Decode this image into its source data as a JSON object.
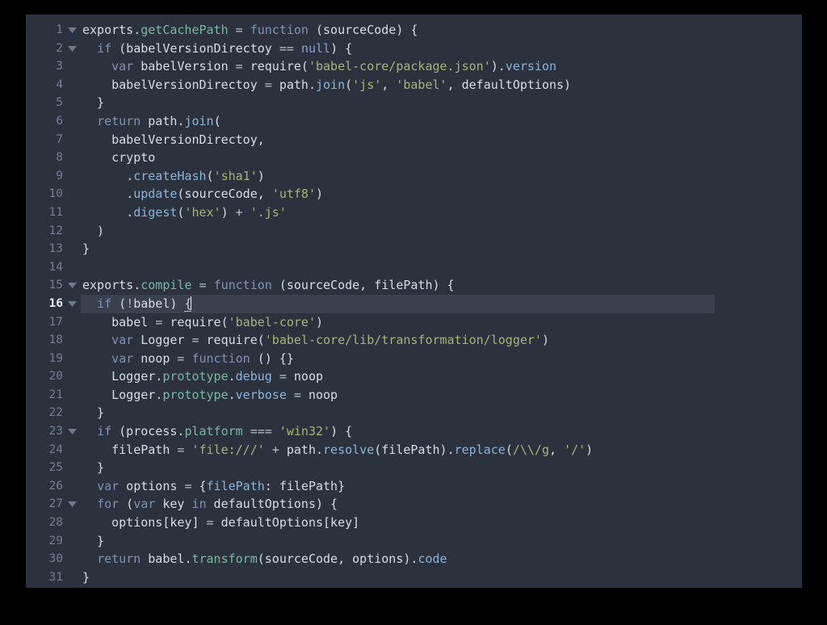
{
  "window": {
    "background_color": "#2c323d",
    "outer_color": "#000000",
    "active_line_color": "#39414f"
  },
  "editor": {
    "language": "JavaScript",
    "active_line": 16,
    "cursor_column": 15,
    "fold_markers": [
      1,
      2,
      15,
      16,
      23,
      27
    ],
    "theme_colors": {
      "background": "#2c323d",
      "foreground": "#d7dce5",
      "keyword": "#7e93b5",
      "function": "#79b8a4",
      "property": "#8ab4d8",
      "string": "#a3b57a",
      "constant": "#8a9fd4",
      "line_number": "#717e95",
      "active_line_number": "#e4e9f0",
      "active_line_bg": "#39414f"
    },
    "lines": [
      {
        "n": "1",
        "tokens": [
          {
            "t": "exports",
            "c": "plain"
          },
          {
            "t": ".",
            "c": "punct"
          },
          {
            "t": "getCachePath",
            "c": "fn"
          },
          {
            "t": " ",
            "c": "plain"
          },
          {
            "t": "=",
            "c": "op"
          },
          {
            "t": " ",
            "c": "plain"
          },
          {
            "t": "function",
            "c": "kw"
          },
          {
            "t": " (sourceCode) {",
            "c": "plain"
          }
        ]
      },
      {
        "n": "2",
        "tokens": [
          {
            "t": "  ",
            "c": "plain"
          },
          {
            "t": "if",
            "c": "kw"
          },
          {
            "t": " (babelVersionDirectoy ",
            "c": "plain"
          },
          {
            "t": "==",
            "c": "op"
          },
          {
            "t": " ",
            "c": "plain"
          },
          {
            "t": "null",
            "c": "const"
          },
          {
            "t": ") {",
            "c": "plain"
          }
        ]
      },
      {
        "n": "3",
        "tokens": [
          {
            "t": "    ",
            "c": "plain"
          },
          {
            "t": "var",
            "c": "kw"
          },
          {
            "t": " babelVersion ",
            "c": "plain"
          },
          {
            "t": "=",
            "c": "op"
          },
          {
            "t": " require(",
            "c": "plain"
          },
          {
            "t": "'babel-core/package.json'",
            "c": "str"
          },
          {
            "t": ")",
            "c": "plain"
          },
          {
            "t": ".",
            "c": "punct"
          },
          {
            "t": "version",
            "c": "prop"
          }
        ]
      },
      {
        "n": "4",
        "tokens": [
          {
            "t": "    babelVersionDirectoy ",
            "c": "plain"
          },
          {
            "t": "=",
            "c": "op"
          },
          {
            "t": " path",
            "c": "plain"
          },
          {
            "t": ".",
            "c": "punct"
          },
          {
            "t": "join",
            "c": "prop"
          },
          {
            "t": "(",
            "c": "plain"
          },
          {
            "t": "'js'",
            "c": "str"
          },
          {
            "t": ", ",
            "c": "plain"
          },
          {
            "t": "'babel'",
            "c": "str"
          },
          {
            "t": ", defaultOptions)",
            "c": "plain"
          }
        ]
      },
      {
        "n": "5",
        "tokens": [
          {
            "t": "  }",
            "c": "plain"
          }
        ]
      },
      {
        "n": "6",
        "tokens": [
          {
            "t": "  ",
            "c": "plain"
          },
          {
            "t": "return",
            "c": "kw"
          },
          {
            "t": " path",
            "c": "plain"
          },
          {
            "t": ".",
            "c": "punct"
          },
          {
            "t": "join",
            "c": "prop"
          },
          {
            "t": "(",
            "c": "plain"
          }
        ]
      },
      {
        "n": "7",
        "tokens": [
          {
            "t": "    babelVersionDirectoy,",
            "c": "plain"
          }
        ]
      },
      {
        "n": "8",
        "tokens": [
          {
            "t": "    crypto",
            "c": "plain"
          }
        ]
      },
      {
        "n": "9",
        "tokens": [
          {
            "t": "      ",
            "c": "plain"
          },
          {
            "t": ".",
            "c": "punct"
          },
          {
            "t": "createHash",
            "c": "prop"
          },
          {
            "t": "(",
            "c": "plain"
          },
          {
            "t": "'sha1'",
            "c": "str"
          },
          {
            "t": ")",
            "c": "plain"
          }
        ]
      },
      {
        "n": "10",
        "tokens": [
          {
            "t": "      ",
            "c": "plain"
          },
          {
            "t": ".",
            "c": "punct"
          },
          {
            "t": "update",
            "c": "prop"
          },
          {
            "t": "(sourceCode, ",
            "c": "plain"
          },
          {
            "t": "'utf8'",
            "c": "str"
          },
          {
            "t": ")",
            "c": "plain"
          }
        ]
      },
      {
        "n": "11",
        "tokens": [
          {
            "t": "      ",
            "c": "plain"
          },
          {
            "t": ".",
            "c": "punct"
          },
          {
            "t": "digest",
            "c": "prop"
          },
          {
            "t": "(",
            "c": "plain"
          },
          {
            "t": "'hex'",
            "c": "str"
          },
          {
            "t": ") ",
            "c": "plain"
          },
          {
            "t": "+",
            "c": "op"
          },
          {
            "t": " ",
            "c": "plain"
          },
          {
            "t": "'.js'",
            "c": "str"
          }
        ]
      },
      {
        "n": "12",
        "tokens": [
          {
            "t": "  )",
            "c": "plain"
          }
        ]
      },
      {
        "n": "13",
        "tokens": [
          {
            "t": "}",
            "c": "plain"
          }
        ]
      },
      {
        "n": "14",
        "tokens": []
      },
      {
        "n": "15",
        "tokens": [
          {
            "t": "exports",
            "c": "plain"
          },
          {
            "t": ".",
            "c": "punct"
          },
          {
            "t": "compile",
            "c": "fn"
          },
          {
            "t": " ",
            "c": "plain"
          },
          {
            "t": "=",
            "c": "op"
          },
          {
            "t": " ",
            "c": "plain"
          },
          {
            "t": "function",
            "c": "kw"
          },
          {
            "t": " (sourceCode, filePath) {",
            "c": "plain"
          }
        ]
      },
      {
        "n": "16",
        "tokens": [
          {
            "t": "  ",
            "c": "plain"
          },
          {
            "t": "if",
            "c": "kw"
          },
          {
            "t": " (",
            "c": "plain"
          },
          {
            "t": "!",
            "c": "op"
          },
          {
            "t": "babel) ",
            "c": "plain"
          },
          {
            "t": "{",
            "c": "match"
          }
        ]
      },
      {
        "n": "17",
        "tokens": [
          {
            "t": "    babel ",
            "c": "plain"
          },
          {
            "t": "=",
            "c": "op"
          },
          {
            "t": " require(",
            "c": "plain"
          },
          {
            "t": "'babel-core'",
            "c": "str"
          },
          {
            "t": ")",
            "c": "plain"
          }
        ]
      },
      {
        "n": "18",
        "tokens": [
          {
            "t": "    ",
            "c": "plain"
          },
          {
            "t": "var",
            "c": "kw"
          },
          {
            "t": " Logger ",
            "c": "plain"
          },
          {
            "t": "=",
            "c": "op"
          },
          {
            "t": " require(",
            "c": "plain"
          },
          {
            "t": "'babel-core/lib/transformation/logger'",
            "c": "str"
          },
          {
            "t": ")",
            "c": "plain"
          }
        ]
      },
      {
        "n": "19",
        "tokens": [
          {
            "t": "    ",
            "c": "plain"
          },
          {
            "t": "var",
            "c": "kw"
          },
          {
            "t": " noop ",
            "c": "plain"
          },
          {
            "t": "=",
            "c": "op"
          },
          {
            "t": " ",
            "c": "plain"
          },
          {
            "t": "function",
            "c": "kw"
          },
          {
            "t": " () {}",
            "c": "plain"
          }
        ]
      },
      {
        "n": "20",
        "tokens": [
          {
            "t": "    Logger",
            "c": "plain"
          },
          {
            "t": ".",
            "c": "punct"
          },
          {
            "t": "prototype",
            "c": "fn"
          },
          {
            "t": ".",
            "c": "punct"
          },
          {
            "t": "debug",
            "c": "prop"
          },
          {
            "t": " ",
            "c": "plain"
          },
          {
            "t": "=",
            "c": "op"
          },
          {
            "t": " noop",
            "c": "plain"
          }
        ]
      },
      {
        "n": "21",
        "tokens": [
          {
            "t": "    Logger",
            "c": "plain"
          },
          {
            "t": ".",
            "c": "punct"
          },
          {
            "t": "prototype",
            "c": "fn"
          },
          {
            "t": ".",
            "c": "punct"
          },
          {
            "t": "verbose",
            "c": "prop"
          },
          {
            "t": " ",
            "c": "plain"
          },
          {
            "t": "=",
            "c": "op"
          },
          {
            "t": " noop",
            "c": "plain"
          }
        ]
      },
      {
        "n": "22",
        "tokens": [
          {
            "t": "  }",
            "c": "plain"
          }
        ]
      },
      {
        "n": "23",
        "tokens": [
          {
            "t": "  ",
            "c": "plain"
          },
          {
            "t": "if",
            "c": "kw"
          },
          {
            "t": " (process",
            "c": "plain"
          },
          {
            "t": ".",
            "c": "punct"
          },
          {
            "t": "platform",
            "c": "fn"
          },
          {
            "t": " ",
            "c": "plain"
          },
          {
            "t": "===",
            "c": "op"
          },
          {
            "t": " ",
            "c": "plain"
          },
          {
            "t": "'win32'",
            "c": "str"
          },
          {
            "t": ") {",
            "c": "plain"
          }
        ]
      },
      {
        "n": "24",
        "tokens": [
          {
            "t": "    filePath ",
            "c": "plain"
          },
          {
            "t": "=",
            "c": "op"
          },
          {
            "t": " ",
            "c": "plain"
          },
          {
            "t": "'file:///'",
            "c": "str"
          },
          {
            "t": " ",
            "c": "plain"
          },
          {
            "t": "+",
            "c": "op"
          },
          {
            "t": " path",
            "c": "plain"
          },
          {
            "t": ".",
            "c": "punct"
          },
          {
            "t": "resolve",
            "c": "prop"
          },
          {
            "t": "(filePath)",
            "c": "plain"
          },
          {
            "t": ".",
            "c": "punct"
          },
          {
            "t": "replace",
            "c": "prop"
          },
          {
            "t": "(",
            "c": "plain"
          },
          {
            "t": "/\\\\/g",
            "c": "regex"
          },
          {
            "t": ", ",
            "c": "plain"
          },
          {
            "t": "'/'",
            "c": "str"
          },
          {
            "t": ")",
            "c": "plain"
          }
        ]
      },
      {
        "n": "25",
        "tokens": [
          {
            "t": "  }",
            "c": "plain"
          }
        ]
      },
      {
        "n": "26",
        "tokens": [
          {
            "t": "  ",
            "c": "plain"
          },
          {
            "t": "var",
            "c": "kw"
          },
          {
            "t": " options ",
            "c": "plain"
          },
          {
            "t": "=",
            "c": "op"
          },
          {
            "t": " {",
            "c": "plain"
          },
          {
            "t": "filePath",
            "c": "prop"
          },
          {
            "t": ": filePath}",
            "c": "plain"
          }
        ]
      },
      {
        "n": "27",
        "tokens": [
          {
            "t": "  ",
            "c": "plain"
          },
          {
            "t": "for",
            "c": "kw"
          },
          {
            "t": " (",
            "c": "plain"
          },
          {
            "t": "var",
            "c": "kw"
          },
          {
            "t": " key ",
            "c": "plain"
          },
          {
            "t": "in",
            "c": "kw"
          },
          {
            "t": " defaultOptions) {",
            "c": "plain"
          }
        ]
      },
      {
        "n": "28",
        "tokens": [
          {
            "t": "    options[key] ",
            "c": "plain"
          },
          {
            "t": "=",
            "c": "op"
          },
          {
            "t": " defaultOptions[key]",
            "c": "plain"
          }
        ]
      },
      {
        "n": "29",
        "tokens": [
          {
            "t": "  }",
            "c": "plain"
          }
        ]
      },
      {
        "n": "30",
        "tokens": [
          {
            "t": "  ",
            "c": "plain"
          },
          {
            "t": "return",
            "c": "kw"
          },
          {
            "t": " babel",
            "c": "plain"
          },
          {
            "t": ".",
            "c": "punct"
          },
          {
            "t": "transform",
            "c": "fn"
          },
          {
            "t": "(sourceCode, options)",
            "c": "plain"
          },
          {
            "t": ".",
            "c": "punct"
          },
          {
            "t": "code",
            "c": "prop"
          }
        ]
      },
      {
        "n": "31",
        "tokens": [
          {
            "t": "}",
            "c": "plain"
          }
        ]
      }
    ]
  }
}
